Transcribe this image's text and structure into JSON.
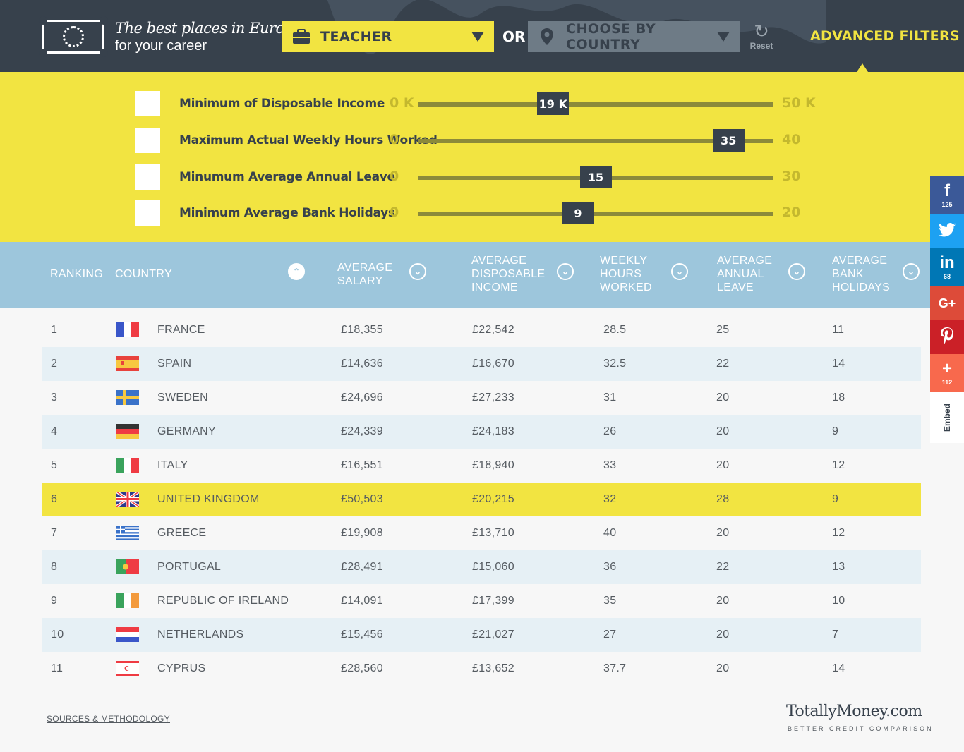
{
  "header": {
    "tagline_1": "The best places in Europe",
    "tagline_2": "for your career",
    "job_dropdown": "TEACHER",
    "or_label": "OR",
    "country_dropdown": "CHOOSE BY COUNTRY",
    "reset_label": "Reset",
    "advanced_filters_label": "ADVANCED FILTERS"
  },
  "filters": [
    {
      "label": "Minimum of Disposable Income",
      "min": "0 K",
      "max": "50 K",
      "value": "19 K",
      "fraction": 0.38
    },
    {
      "label": "Maximum Actual Weekly Hours Worked",
      "min": "0",
      "max": "40",
      "value": "35",
      "fraction": 0.875
    },
    {
      "label": "Minumum Average Annual Leave",
      "min": "0",
      "max": "30",
      "value": "15",
      "fraction": 0.5
    },
    {
      "label": "Minimum Average Bank Holidays",
      "min": "0",
      "max": "20",
      "value": "9",
      "fraction": 0.45
    }
  ],
  "columns": {
    "ranking": "RANKING",
    "country": "COUNTRY",
    "salary": "AVERAGE SALARY",
    "disposable": "AVERAGE DISPOSABLE INCOME",
    "hours": "WEEKLY HOURS WORKED",
    "leave": "AVERAGE ANNUAL LEAVE",
    "holidays": "AVERAGE BANK HOLIDAYS"
  },
  "rows": [
    {
      "rank": "1",
      "country": "FRANCE",
      "salary": "£18,355",
      "disposable": "£22,542",
      "hours": "28.5",
      "leave": "25",
      "holidays": "11"
    },
    {
      "rank": "2",
      "country": "SPAIN",
      "salary": "£14,636",
      "disposable": "£16,670",
      "hours": "32.5",
      "leave": "22",
      "holidays": "14"
    },
    {
      "rank": "3",
      "country": "SWEDEN",
      "salary": "£24,696",
      "disposable": "£27,233",
      "hours": "31",
      "leave": "20",
      "holidays": "18"
    },
    {
      "rank": "4",
      "country": "GERMANY",
      "salary": "£24,339",
      "disposable": "£24,183",
      "hours": "26",
      "leave": "20",
      "holidays": "9"
    },
    {
      "rank": "5",
      "country": "ITALY",
      "salary": "£16,551",
      "disposable": "£18,940",
      "hours": "33",
      "leave": "20",
      "holidays": "12"
    },
    {
      "rank": "6",
      "country": "UNITED KINGDOM",
      "salary": "£50,503",
      "disposable": "£20,215",
      "hours": "32",
      "leave": "28",
      "holidays": "9"
    },
    {
      "rank": "7",
      "country": "GREECE",
      "salary": "£19,908",
      "disposable": "£13,710",
      "hours": "40",
      "leave": "20",
      "holidays": "12"
    },
    {
      "rank": "8",
      "country": "PORTUGAL",
      "salary": "£28,491",
      "disposable": "£15,060",
      "hours": "36",
      "leave": "22",
      "holidays": "13"
    },
    {
      "rank": "9",
      "country": "REPUBLIC OF IRELAND",
      "salary": "£14,091",
      "disposable": "£17,399",
      "hours": "35",
      "leave": "20",
      "holidays": "10"
    },
    {
      "rank": "10",
      "country": "NETHERLANDS",
      "salary": "£15,456",
      "disposable": "£21,027",
      "hours": "27",
      "leave": "20",
      "holidays": "7"
    },
    {
      "rank": "11",
      "country": "CYPRUS",
      "salary": "£28,560",
      "disposable": "£13,652",
      "hours": "37.7",
      "leave": "20",
      "holidays": "14"
    }
  ],
  "footer": {
    "sources_link": "SOURCES & METHODOLOGY",
    "brand": "TotallyMoney.com",
    "brand_sub": "BETTER CREDIT COMPARISON"
  },
  "social": {
    "facebook_count": "125",
    "linkedin_count": "68",
    "more_count": "112",
    "embed_label": "Embed"
  },
  "colors": {
    "header_bg": "#37414c",
    "accent_yellow": "#f2e441",
    "table_header_bg": "#9dc6dc"
  }
}
